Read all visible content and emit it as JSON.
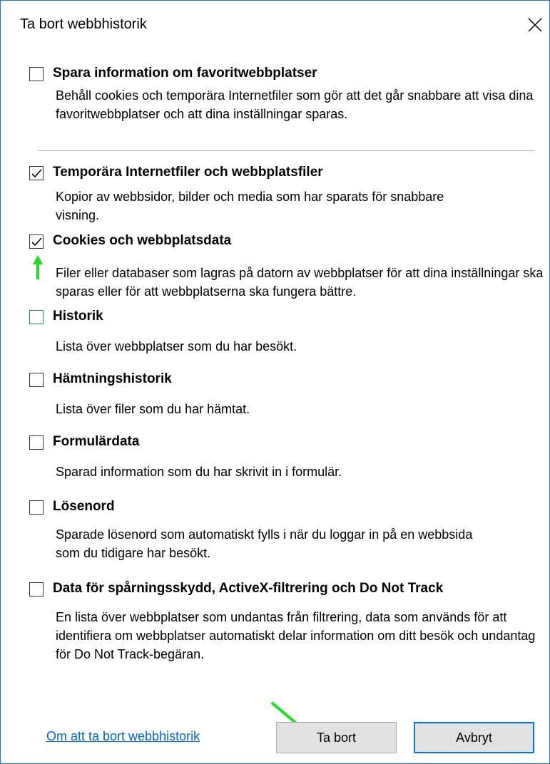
{
  "window": {
    "title": "Ta bort webbhistorik",
    "close_icon": "close-icon"
  },
  "options": [
    {
      "label": "Spara information om favoritwebbplatser",
      "checked": false,
      "desc": "Behåll cookies och temporära Internetfiler som gör att det går snabbare att visa dina favoritwebbplatser och att dina inställningar sparas."
    },
    {
      "label": "Temporära Internetfiler och webbplatsfiler",
      "checked": true,
      "desc": "Kopior av webbsidor, bilder och media som har sparats för snabbare visning."
    },
    {
      "label": "Cookies och webbplatsdata",
      "checked": true,
      "desc": "Filer eller databaser som lagras på datorn av webbplatser för att dina inställningar ska sparas eller för att webbplatserna ska fungera bättre."
    },
    {
      "label": "Historik",
      "checked": false,
      "desc": "Lista över webbplatser som du har besökt."
    },
    {
      "label": "Hämtningshistorik",
      "checked": false,
      "desc": "Lista över filer som du har hämtat."
    },
    {
      "label": "Formulärdata",
      "checked": false,
      "desc": "Sparad information som du har skrivit in i formulär."
    },
    {
      "label": "Lösenord",
      "checked": false,
      "desc": "Sparade lösenord som automatiskt fylls i när du loggar in på en webbsida som du tidigare har besökt."
    },
    {
      "label": "Data för spårningsskydd, ActiveX-filtrering och Do Not Track",
      "checked": false,
      "desc": "En lista över webbplatser som undantas från filtrering, data som används för att identifiera om webbplatser automatiskt delar information om ditt besök och undantag för Do Not Track-begäran."
    }
  ],
  "footer": {
    "link": "Om att ta bort webbhistorik",
    "delete_label": "Ta bort",
    "cancel_label": "Avbryt"
  },
  "colors": {
    "accent": "#0078d7",
    "annotation_arrow": "#22dd22",
    "link": "#0066cc"
  }
}
